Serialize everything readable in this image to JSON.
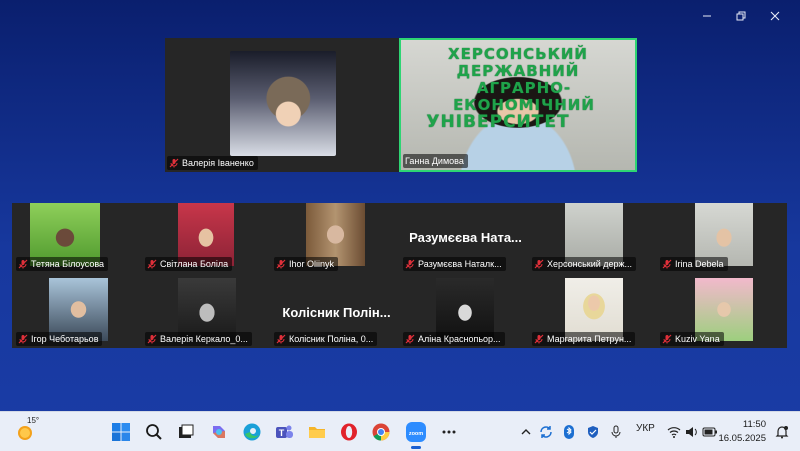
{
  "window": {
    "controls": [
      "minimize-icon",
      "restore-icon",
      "close-icon"
    ]
  },
  "top_tiles": [
    {
      "name": "Валерія Іваненко",
      "muted": true
    },
    {
      "name": "Ганна Димова",
      "muted": false,
      "active_speaker": true,
      "banner": [
        "ХЕРСОНСЬКИЙ ДЕРЖАВНИЙ",
        "АГРАРНО-ЕКОНОМІЧНИЙ",
        "УНІВЕРСИТЕТ"
      ]
    }
  ],
  "gallery": {
    "row1": [
      {
        "name": "Тетяна Білоусова",
        "muted": true
      },
      {
        "name": "Світлана Боліла",
        "muted": true
      },
      {
        "name": "Ihor Oliinyk",
        "muted": true
      },
      {
        "name": "Разумєєва Наталк...",
        "muted": true,
        "video_off_label": "Разумєєва Ната..."
      },
      {
        "name": "Херсонський держ...",
        "muted": true
      },
      {
        "name": "Irina Debela",
        "muted": true
      }
    ],
    "row2": [
      {
        "name": "Ігор Чеботарьов",
        "muted": true
      },
      {
        "name": "Валерія Керкало_0...",
        "muted": true
      },
      {
        "name": "Колісник Поліна, 0...",
        "muted": true,
        "video_off_label": "Колісник Полін..."
      },
      {
        "name": "Аліна Краснопьор...",
        "muted": true
      },
      {
        "name": "Маргарита Петрун...",
        "muted": true
      },
      {
        "name": "Kuziv Yana",
        "muted": true
      }
    ]
  },
  "taskbar": {
    "weather_temp": "15°",
    "apps": [
      "windows-start-icon",
      "search-icon",
      "task-view-icon",
      "copilot-icon",
      "edge-icon",
      "teams-icon",
      "file-explorer-icon",
      "opera-icon",
      "chrome-icon",
      "zoom-icon",
      "more-icon"
    ],
    "language": "УКР",
    "time": "11:50",
    "date": "16.05.2025"
  },
  "colors": {
    "background_top": "#0a1f6e",
    "background_bottom": "#1a3ca6",
    "tile_bg": "#262626",
    "active_speaker_border": "#2ed573",
    "mute_red": "#e0303a"
  }
}
